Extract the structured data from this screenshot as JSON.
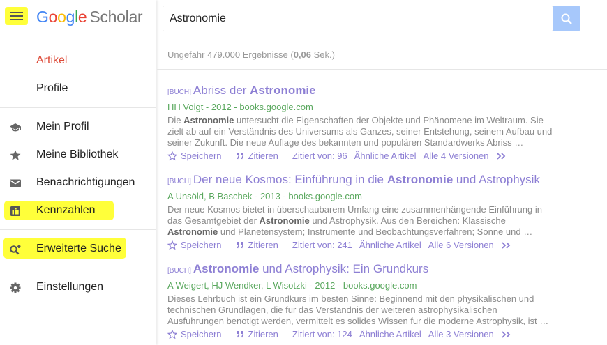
{
  "logo": {
    "google": "Google",
    "scholar": "Scholar"
  },
  "search": {
    "value": "Astronomie"
  },
  "nav": {
    "artikel": "Artikel",
    "profile": "Profile",
    "mein_profil": "Mein Profil",
    "meine_bibliothek": "Meine Bibliothek",
    "benachrichtigungen": "Benachrichtigungen",
    "kennzahlen": "Kennzahlen",
    "erweiterte_suche": "Erweiterte Suche",
    "einstellungen": "Einstellungen"
  },
  "colors": {
    "highlight": "#ffff3a",
    "link": "#8d7fd4",
    "meta": "#5aa85e",
    "active_nav": "#dd4b39",
    "search_button": "#a7c8fb"
  },
  "results_info": {
    "prefix": "Ungefähr 479.000 Ergebnisse (",
    "time": "0,06",
    "suffix": " Sek.)"
  },
  "results": [
    {
      "tag": "[BUCH]",
      "title_parts": [
        "Abriss der ",
        "Astronomie",
        ""
      ],
      "meta": "HH Voigt - 2012 - books.google.com",
      "snippet": [
        "Die ",
        "Astronomie",
        " untersucht die Eigenschaften der Objekte und Phänomene im Weltraum. Sie zielt ab auf ein Verständnis des Universums als Ganzes, seiner Entstehung, seinem Aufbau und seiner Zukunft. Die neue Auflage des bekannten und populären Standardwerks Abriss …"
      ],
      "actions": {
        "save": "Speichern",
        "cite": "Zitieren",
        "cited": "Zitiert von: 96",
        "related": "Ähnliche Artikel",
        "versions": "Alle 4 Versionen"
      }
    },
    {
      "tag": "[BUCH]",
      "title_parts": [
        "Der neue Kosmos: Einführung in die ",
        "Astronomie",
        " und Astrophysik"
      ],
      "meta": "A Unsöld, B Baschek - 2013 - books.google.com",
      "snippet": [
        "Der neue Kosmos bietet in überschaubarem Umfang eine zusammenhängende Einführung in das Gesamtgebiet der ",
        "Astronomie",
        " und Astrophysik. Aus den Bereichen: Klassische ",
        "Astronomie",
        " und Planetensystem; Instrumente und Beobachtungsverfahren; Sonne und …"
      ],
      "actions": {
        "save": "Speichern",
        "cite": "Zitieren",
        "cited": "Zitiert von: 241",
        "related": "Ähnliche Artikel",
        "versions": "Alle 6 Versionen"
      }
    },
    {
      "tag": "[BUCH]",
      "title_parts": [
        "",
        "Astronomie",
        " und Astrophysik: Ein Grundkurs"
      ],
      "meta": "A Weigert, HJ Wendker, L Wisotzki - 2012 - books.google.com",
      "snippet": [
        "Dieses Lehrbuch ist ein Grundkurs im besten Sinne: Beginnend mit den physikalischen und technischen Grundlagen, die fur das Verstandnis der weiteren astrophysikalischen Ausfuhrungen benotigt werden, vermittelt es solides Wissen fur die moderne Astrophysik, ist …"
      ],
      "actions": {
        "save": "Speichern",
        "cite": "Zitieren",
        "cited": "Zitiert von: 124",
        "related": "Ähnliche Artikel",
        "versions": "Alle 3 Versionen"
      }
    }
  ]
}
